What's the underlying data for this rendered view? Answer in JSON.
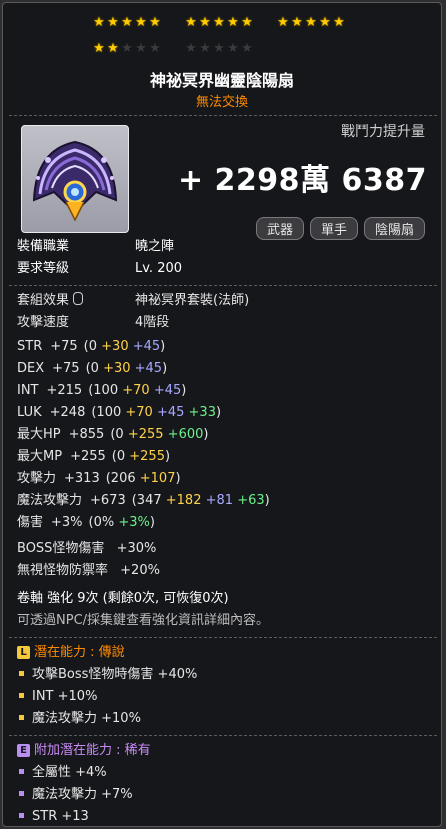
{
  "stars": {
    "total": 25,
    "lit": 17,
    "groups": [
      5,
      5,
      5,
      5,
      5
    ]
  },
  "item": {
    "name": "神祕冥界幽靈陰陽扇",
    "trade": "無法交換",
    "icon": "ghost-fan-icon"
  },
  "combat": {
    "label": "戰鬥力提升量",
    "value": "+ 2298萬 6387"
  },
  "tags": [
    "武器",
    "單手",
    "陰陽扇"
  ],
  "req": [
    {
      "label": "裝備職業",
      "value": "曉之陣"
    },
    {
      "label": "要求等級",
      "value": "Lv. 200"
    }
  ],
  "set": {
    "label": "套組效果",
    "value": "神祕冥界套裝(法師)",
    "icon": "mouse-icon"
  },
  "speed": {
    "label": "攻擊速度",
    "value": "4階段"
  },
  "stats": [
    {
      "label": "STR",
      "total": "+75",
      "base": "(0 ",
      "yellow": "+30",
      "blue": " +45",
      "green": "",
      "close": ")"
    },
    {
      "label": "DEX",
      "total": "+75",
      "base": "(0 ",
      "yellow": "+30",
      "blue": " +45",
      "green": "",
      "close": ")"
    },
    {
      "label": "INT",
      "total": "+215",
      "base": "(100 ",
      "yellow": "+70",
      "blue": " +45",
      "green": "",
      "close": ")"
    },
    {
      "label": "LUK",
      "total": "+248",
      "base": "(100 ",
      "yellow": "+70",
      "blue": " +45",
      "green": " +33",
      "close": ")"
    },
    {
      "label": "最大HP",
      "total": "+855",
      "base": "(0 ",
      "yellow": "+255",
      "blue": "",
      "green": " +600",
      "close": ")"
    },
    {
      "label": "最大MP",
      "total": "+255",
      "base": "(0 ",
      "yellow": "+255",
      "blue": "",
      "green": "",
      "close": ")"
    },
    {
      "label": "攻擊力",
      "total": "+313",
      "base": "(206 ",
      "yellow": "+107",
      "blue": "",
      "green": "",
      "close": ")"
    },
    {
      "label": "魔法攻擊力",
      "total": "+673",
      "base": "(347 ",
      "yellow": "+182",
      "blue": " +81",
      "green": " +63",
      "close": ")"
    },
    {
      "label": "傷害",
      "total": "+3%",
      "base": "(0% ",
      "yellow": "",
      "blue": "",
      "green": "+3%",
      "close": ")"
    }
  ],
  "extras": [
    {
      "label": "BOSS怪物傷害",
      "value": "+30%"
    },
    {
      "label": "無視怪物防禦率",
      "value": "+20%"
    }
  ],
  "scroll": {
    "text": "卷軸 強化 9次 (剩餘0次, 可恢復0次)",
    "hint": "可透過NPC/採集鍵查看強化資訊詳細內容。"
  },
  "potential": {
    "badge": "L",
    "head": "潛在能力 : 傳說",
    "lines": [
      "攻擊Boss怪物時傷害 +40%",
      "INT +10%",
      "魔法攻擊力 +10%"
    ],
    "color": "#f5c93c"
  },
  "additional": {
    "badge": "E",
    "head": "附加潛在能力 : 稀有",
    "lines": [
      "全屬性 +4%",
      "魔法攻擊力 +7%",
      "STR +13"
    ],
    "color": "#b990f0"
  }
}
